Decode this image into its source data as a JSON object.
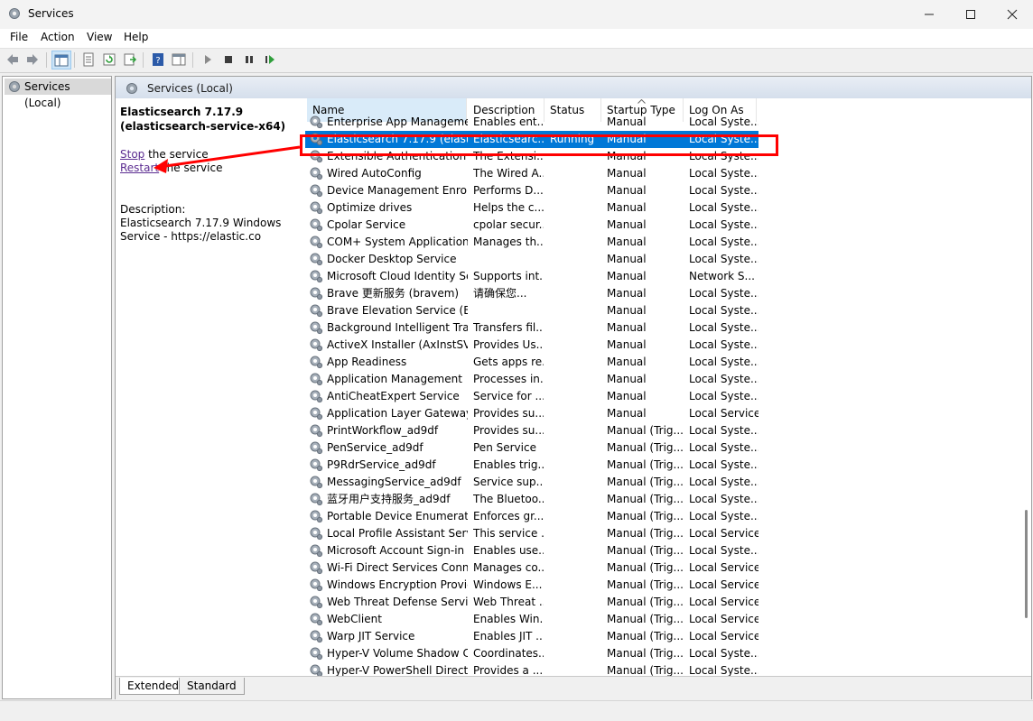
{
  "window": {
    "title": "Services"
  },
  "menu": [
    "File",
    "Action",
    "View",
    "Help"
  ],
  "tree": {
    "root_label": "Services (Local)"
  },
  "pane": {
    "header_title": "Services (Local)"
  },
  "details": {
    "service_title": "Elasticsearch 7.17.9 (elasticsearch-service-x64)",
    "stop_link": "Stop",
    "stop_rest": " the service",
    "restart_link": "Restart",
    "restart_rest": " the service",
    "description_label": "Description:",
    "description_text": "Elasticsearch 7.17.9 Windows Service - https://elastic.co"
  },
  "columns": [
    {
      "label": "Name"
    },
    {
      "label": "Description"
    },
    {
      "label": "Status"
    },
    {
      "label": "Startup Type"
    },
    {
      "label": "Log On As"
    }
  ],
  "services": [
    {
      "name": "Enterprise App Managemen...",
      "description": "Enables ent...",
      "status": "",
      "startup": "Manual",
      "logon": "Local Syste..."
    },
    {
      "name": "Elasticsearch 7.17.9 (elastics...",
      "description": "Elasticsearc...",
      "status": "Running",
      "startup": "Manual",
      "logon": "Local Syste...",
      "selected": true
    },
    {
      "name": "Extensible Authentication P...",
      "description": "The Extensi...",
      "status": "",
      "startup": "Manual",
      "logon": "Local Syste..."
    },
    {
      "name": "Wired AutoConfig",
      "description": "The Wired A...",
      "status": "",
      "startup": "Manual",
      "logon": "Local Syste..."
    },
    {
      "name": "Device Management Enroll...",
      "description": "Performs D...",
      "status": "",
      "startup": "Manual",
      "logon": "Local Syste..."
    },
    {
      "name": "Optimize drives",
      "description": "Helps the c...",
      "status": "",
      "startup": "Manual",
      "logon": "Local Syste..."
    },
    {
      "name": "Cpolar Service",
      "description": "cpolar secur...",
      "status": "",
      "startup": "Manual",
      "logon": "Local Syste..."
    },
    {
      "name": "COM+ System Application",
      "description": "Manages th...",
      "status": "",
      "startup": "Manual",
      "logon": "Local Syste..."
    },
    {
      "name": "Docker Desktop Service",
      "description": "",
      "status": "",
      "startup": "Manual",
      "logon": "Local Syste..."
    },
    {
      "name": "Microsoft Cloud Identity Se...",
      "description": "Supports int...",
      "status": "",
      "startup": "Manual",
      "logon": "Network S..."
    },
    {
      "name": "Brave 更新服务 (bravem)",
      "description": "请确保您...",
      "status": "",
      "startup": "Manual",
      "logon": "Local Syste..."
    },
    {
      "name": "Brave Elevation Service (Bra...",
      "description": "",
      "status": "",
      "startup": "Manual",
      "logon": "Local Syste..."
    },
    {
      "name": "Background Intelligent Tran...",
      "description": "Transfers fil...",
      "status": "",
      "startup": "Manual",
      "logon": "Local Syste..."
    },
    {
      "name": "ActiveX Installer (AxInstSV)",
      "description": "Provides Us...",
      "status": "",
      "startup": "Manual",
      "logon": "Local Syste..."
    },
    {
      "name": "App Readiness",
      "description": "Gets apps re...",
      "status": "",
      "startup": "Manual",
      "logon": "Local Syste..."
    },
    {
      "name": "Application Management",
      "description": "Processes in...",
      "status": "",
      "startup": "Manual",
      "logon": "Local Syste..."
    },
    {
      "name": "AntiCheatExpert Service",
      "description": "Service for ...",
      "status": "",
      "startup": "Manual",
      "logon": "Local Syste..."
    },
    {
      "name": "Application Layer Gateway ...",
      "description": "Provides su...",
      "status": "",
      "startup": "Manual",
      "logon": "Local Service"
    },
    {
      "name": "PrintWorkflow_ad9df",
      "description": "Provides su...",
      "status": "",
      "startup": "Manual (Trig...",
      "logon": "Local Syste..."
    },
    {
      "name": "PenService_ad9df",
      "description": "Pen Service",
      "status": "",
      "startup": "Manual (Trig...",
      "logon": "Local Syste..."
    },
    {
      "name": "P9RdrService_ad9df",
      "description": "Enables trig...",
      "status": "",
      "startup": "Manual (Trig...",
      "logon": "Local Syste..."
    },
    {
      "name": "MessagingService_ad9df",
      "description": "Service sup...",
      "status": "",
      "startup": "Manual (Trig...",
      "logon": "Local Syste..."
    },
    {
      "name": "蓝牙用户支持服务_ad9df",
      "description": "The Bluetoo...",
      "status": "",
      "startup": "Manual (Trig...",
      "logon": "Local Syste..."
    },
    {
      "name": "Portable Device Enumerator...",
      "description": "Enforces gr...",
      "status": "",
      "startup": "Manual (Trig...",
      "logon": "Local Syste..."
    },
    {
      "name": "Local Profile Assistant Service",
      "description": "This service ...",
      "status": "",
      "startup": "Manual (Trig...",
      "logon": "Local Service"
    },
    {
      "name": "Microsoft Account Sign-in ...",
      "description": "Enables use...",
      "status": "",
      "startup": "Manual (Trig...",
      "logon": "Local Syste..."
    },
    {
      "name": "Wi-Fi Direct Services Conne...",
      "description": "Manages co...",
      "status": "",
      "startup": "Manual (Trig...",
      "logon": "Local Service"
    },
    {
      "name": "Windows Encryption Provid...",
      "description": "Windows E...",
      "status": "",
      "startup": "Manual (Trig...",
      "logon": "Local Service"
    },
    {
      "name": "Web Threat Defense Service",
      "description": "Web Threat ...",
      "status": "",
      "startup": "Manual (Trig...",
      "logon": "Local Service"
    },
    {
      "name": "WebClient",
      "description": "Enables Win...",
      "status": "",
      "startup": "Manual (Trig...",
      "logon": "Local Service"
    },
    {
      "name": "Warp JIT Service",
      "description": "Enables JIT ...",
      "status": "",
      "startup": "Manual (Trig...",
      "logon": "Local Service"
    },
    {
      "name": "Hyper-V Volume Shadow C...",
      "description": "Coordinates...",
      "status": "",
      "startup": "Manual (Trig...",
      "logon": "Local Syste..."
    },
    {
      "name": "Hyper-V PowerShell Direct ...",
      "description": "Provides a ...",
      "status": "",
      "startup": "Manual (Trig...",
      "logon": "Local Syste..."
    }
  ],
  "tabs": [
    "Extended",
    "Standard"
  ],
  "colors": {
    "selection": "#0078d7",
    "annotation": "#ff0000",
    "link": "#5c2d91"
  }
}
